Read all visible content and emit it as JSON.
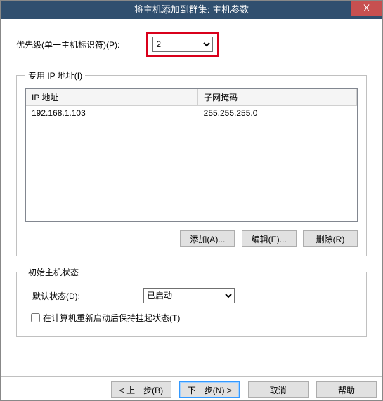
{
  "title": "将主机添加到群集: 主机参数",
  "close": "X",
  "priority": {
    "label": "优先级(单一主机标识符)(P):",
    "value": "2"
  },
  "ip_group": {
    "legend": "专用 IP 地址(I)",
    "cols": {
      "ip": "IP 地址",
      "mask": "子网掩码"
    },
    "rows": [
      {
        "ip": "192.168.1.103",
        "mask": "255.255.255.0"
      }
    ],
    "buttons": {
      "add": "添加(A)...",
      "edit": "编辑(E)...",
      "remove": "删除(R)"
    }
  },
  "status_group": {
    "legend": "初始主机状态",
    "default_label": "默认状态(D):",
    "default_value": "已启动",
    "retain_label": "在计算机重新启动后保持挂起状态(T)"
  },
  "nav": {
    "back": "< 上一步(B)",
    "next": "下一步(N) >",
    "cancel": "取消",
    "help": "帮助"
  }
}
